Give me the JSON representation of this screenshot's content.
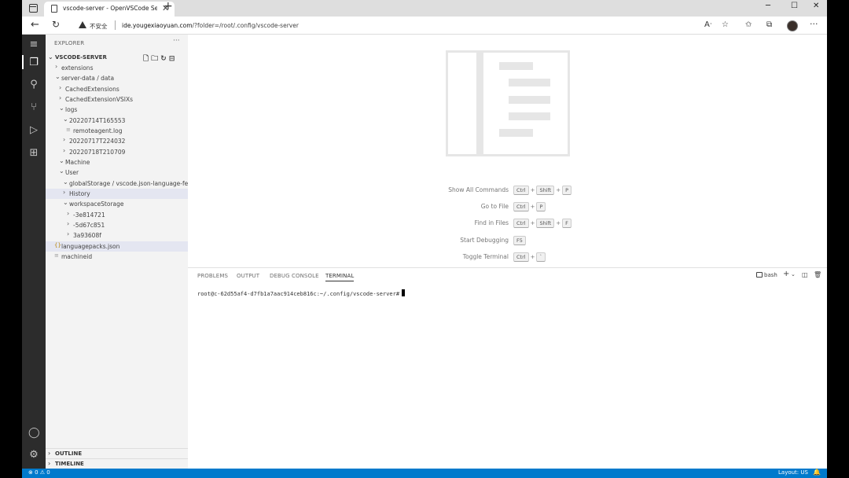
{
  "browser": {
    "tab_title": "vscode-server - OpenVSCode Se",
    "tab_close": "✕",
    "new_tab": "+",
    "minimize": "─",
    "maximize": "☐",
    "close": "✕",
    "security_label": "不安全",
    "url_host": "ide.yougexiaoyuan.com",
    "url_path": "/?folder=/root/.config/vscode-server",
    "icons": [
      "read-aloud-icon",
      "add-favorite-icon",
      "favorites-icon",
      "collections-icon",
      "profile-avatar",
      "more-icon"
    ]
  },
  "sidebar": {
    "title": "EXPLORER",
    "more": "···",
    "root_label": "VSCODE-SERVER",
    "tree": [
      {
        "label": "extensions",
        "chev": "›",
        "depth": 1
      },
      {
        "label": "server-data / data",
        "chev": "⌄",
        "depth": 1
      },
      {
        "label": "CachedExtensions",
        "chev": "›",
        "depth": 2
      },
      {
        "label": "CachedExtensionVSIXs",
        "chev": "›",
        "depth": 2
      },
      {
        "label": "logs",
        "chev": "⌄",
        "depth": 2
      },
      {
        "label": "20220714T165553",
        "chev": "⌄",
        "depth": 3
      },
      {
        "label": "remoteagent.log",
        "chev": "",
        "depth": 4,
        "icon": "≡"
      },
      {
        "label": "20220717T224032",
        "chev": "›",
        "depth": 3
      },
      {
        "label": "20220718T210709",
        "chev": "›",
        "depth": 3
      },
      {
        "label": "Machine",
        "chev": "⌄",
        "depth": 2
      },
      {
        "label": "User",
        "chev": "⌄",
        "depth": 2
      },
      {
        "label": "globalStorage / vscode.json-language-fea...",
        "chev": "⌄",
        "depth": 3
      },
      {
        "label": "History",
        "chev": "›",
        "depth": 3
      },
      {
        "label": "workspaceStorage",
        "chev": "⌄",
        "depth": 3
      },
      {
        "label": "-3e814721",
        "chev": "›",
        "depth": 4
      },
      {
        "label": "-5d67c851",
        "chev": "›",
        "depth": 4
      },
      {
        "label": "3a93608f",
        "chev": "›",
        "depth": 4
      },
      {
        "label": "languagepacks.json",
        "chev": "",
        "depth": 1,
        "icon": "{}"
      },
      {
        "label": "machineid",
        "chev": "",
        "depth": 1,
        "icon": "≡"
      }
    ],
    "outline_label": "OUTLINE",
    "timeline_label": "TIMELINE"
  },
  "editor": {
    "shortcuts": [
      {
        "label": "Show All Commands",
        "keys": [
          "Ctrl",
          "Shift",
          "P"
        ]
      },
      {
        "label": "Go to File",
        "keys": [
          "Ctrl",
          "P"
        ]
      },
      {
        "label": "Find in Files",
        "keys": [
          "Ctrl",
          "Shift",
          "F"
        ]
      },
      {
        "label": "Start Debugging",
        "keys": [
          "F5"
        ]
      },
      {
        "label": "Toggle Terminal",
        "keys": [
          "Ctrl",
          "`"
        ]
      }
    ]
  },
  "panel": {
    "tabs": [
      "PROBLEMS",
      "OUTPUT",
      "DEBUG CONSOLE",
      "TERMINAL"
    ],
    "active_tab": "TERMINAL",
    "terminal_name": "bash",
    "prompt": "root@c-62d55af4-d7fb1a7aac914ceb816c:~/.config/vscode-server#"
  },
  "status": {
    "errors_warnings": "⊗ 0 ⚠ 0",
    "layout": "Layout: US",
    "bell": "🔔"
  }
}
